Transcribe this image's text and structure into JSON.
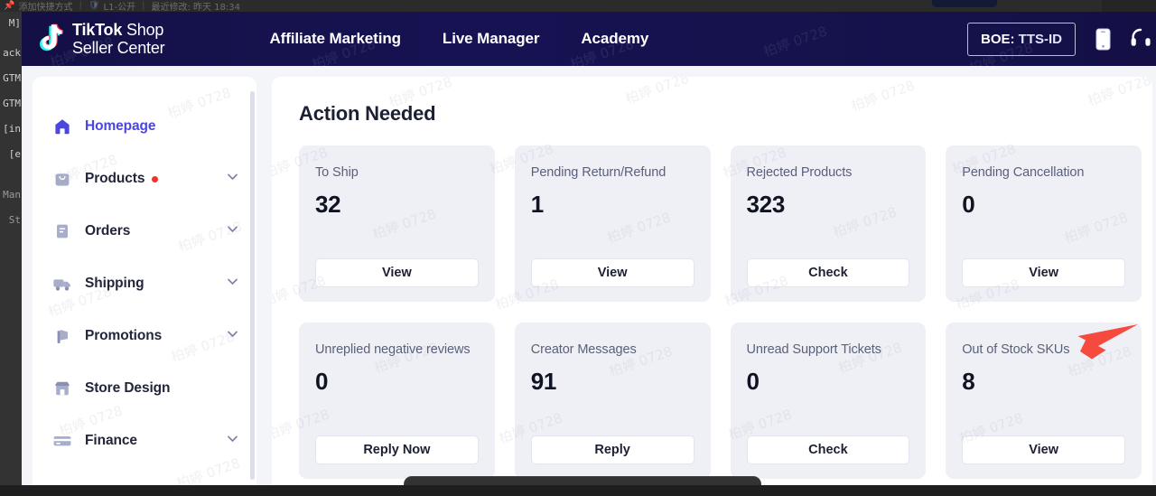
{
  "os": {
    "topbar": {
      "pin_icon": "pin-icon",
      "add_shortcut": "添加快捷方式",
      "sep1": "|",
      "shield_icon": "shield-icon",
      "level": "L1-公开",
      "sep2": "|",
      "last_modified": "最近修改: 昨天 18:34"
    },
    "left_panel_lines": [
      "M]",
      "ack",
      "GTM",
      "GTM",
      "[in",
      "[e",
      "Man",
      "St"
    ]
  },
  "header": {
    "brand": {
      "logo_icon": "tiktok-note-icon",
      "line1_bold": "TikTok",
      "line1_normal": "Shop",
      "line2": "Seller Center"
    },
    "nav": [
      {
        "label": "Affiliate Marketing"
      },
      {
        "label": "Live Manager"
      },
      {
        "label": "Academy"
      }
    ],
    "region_chip": {
      "prefix": "BOE: ",
      "value": "TTS-ID"
    },
    "icons": [
      {
        "name": "mobile-phone-icon"
      },
      {
        "name": "headset-support-icon"
      }
    ]
  },
  "sidebar": {
    "items": [
      {
        "label": "Homepage",
        "icon": "home-icon",
        "active": true,
        "expandable": false,
        "badge": false
      },
      {
        "label": "Products",
        "icon": "bag-icon",
        "active": false,
        "expandable": true,
        "badge": true
      },
      {
        "label": "Orders",
        "icon": "order-book-icon",
        "active": false,
        "expandable": true,
        "badge": false
      },
      {
        "label": "Shipping",
        "icon": "truck-icon",
        "active": false,
        "expandable": true,
        "badge": false
      },
      {
        "label": "Promotions",
        "icon": "megaphone-icon",
        "active": false,
        "expandable": true,
        "badge": false
      },
      {
        "label": "Store Design",
        "icon": "storefront-icon",
        "active": false,
        "expandable": false,
        "badge": false
      },
      {
        "label": "Finance",
        "icon": "card-icon",
        "active": false,
        "expandable": true,
        "badge": false
      }
    ]
  },
  "main": {
    "title": "Action Needed",
    "cards": [
      {
        "title": "To Ship",
        "value": "32",
        "action": "View"
      },
      {
        "title": "Pending Return/Refund",
        "value": "1",
        "action": "View"
      },
      {
        "title": "Rejected Products",
        "value": "323",
        "action": "Check"
      },
      {
        "title": "Pending Cancellation",
        "value": "0",
        "action": "View"
      },
      {
        "title": "Unreplied negative reviews",
        "value": "0",
        "action": "Reply Now"
      },
      {
        "title": "Creator Messages",
        "value": "91",
        "action": "Reply"
      },
      {
        "title": "Unread Support Tickets",
        "value": "0",
        "action": "Check"
      },
      {
        "title": "Out of Stock SKUs",
        "value": "8",
        "action": "View"
      }
    ]
  },
  "annotation": {
    "arrow_icon": "red-arrow-icon",
    "arrow_color": "#f54a3d",
    "target_card": "Out of Stock SKUs"
  },
  "watermark": {
    "text": "柏婷 0728"
  },
  "colors": {
    "header_bg": "#16144a",
    "accent": "#4a46e0",
    "card_bg": "#eff0f6",
    "page_bg": "#f4f5f9",
    "badge_red": "#f5302b"
  }
}
